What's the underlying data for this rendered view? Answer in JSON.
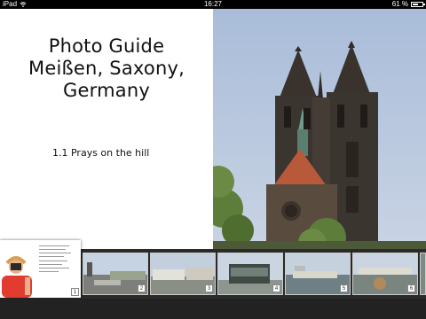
{
  "status_bar": {
    "device": "iPad",
    "time": "16:27",
    "battery": "61 %",
    "battery_level": 0.61
  },
  "page": {
    "title_lines": [
      "Photo Guide",
      "Meißen, Saxony,",
      "Germany"
    ],
    "section": "1.1 Prays on the hill"
  },
  "thumbnails": [
    {
      "page": "1"
    },
    {
      "page": "2"
    },
    {
      "page": "3"
    },
    {
      "page": "4"
    },
    {
      "page": "5"
    },
    {
      "page": "6"
    }
  ],
  "colors": {
    "sky": "#9fb6d6",
    "stone": "#3b3530",
    "roof": "#b85a3a",
    "tree": "#5d7d3a"
  }
}
